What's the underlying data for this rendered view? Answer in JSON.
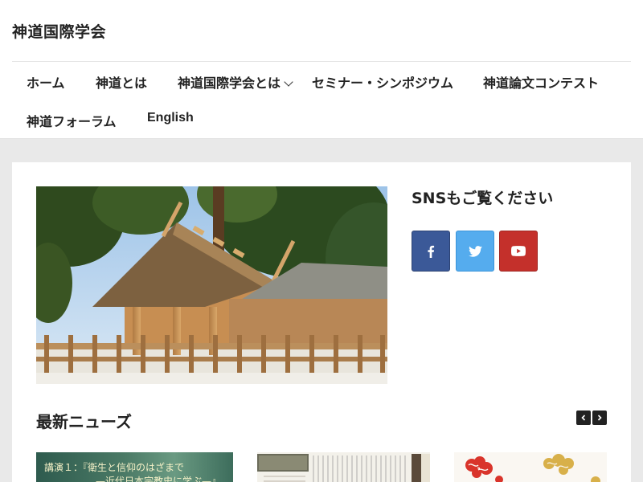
{
  "site": {
    "title": "神道国際学会"
  },
  "nav": {
    "items": [
      {
        "label": "ホーム"
      },
      {
        "label": "神道とは"
      },
      {
        "label": "神道国際学会とは",
        "has_dropdown": true
      },
      {
        "label": "セミナー・シンポジウム"
      },
      {
        "label": "神道論文コンテスト"
      },
      {
        "label": "神道フォーラム"
      },
      {
        "label": "English"
      }
    ]
  },
  "sidebar": {
    "sns_title": "SNSもご覧ください",
    "buttons": [
      {
        "icon": "facebook-icon",
        "color": "#3b5998"
      },
      {
        "icon": "twitter-icon",
        "color": "#55acee"
      },
      {
        "icon": "youtube-icon",
        "color": "#c4302b"
      }
    ]
  },
  "news": {
    "title": "最新ニューズ",
    "thumb1": {
      "line1": "講演１：『衛生と信仰のはざまで",
      "line2": "—近代日本宗教史に学ぶ—』"
    }
  }
}
